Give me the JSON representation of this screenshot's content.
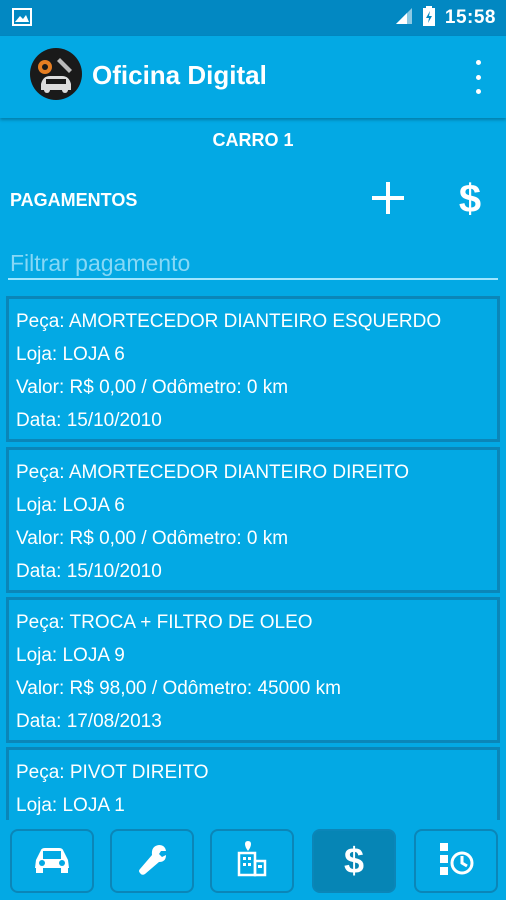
{
  "status_bar": {
    "time": "15:58"
  },
  "app_bar": {
    "title": "Oficina Digital"
  },
  "header": {
    "car_title": "CARRO 1",
    "section_label": "PAGAMENTOS",
    "add_icon": "plus-icon",
    "payment_icon": "dollar-icon",
    "payment_symbol": "$"
  },
  "filter": {
    "placeholder": "Filtrar pagamento",
    "value": ""
  },
  "payments": [
    {
      "peca": "Peça: AMORTECEDOR DIANTEIRO ESQUERDO",
      "loja": "Loja: LOJA 6",
      "valor": "Valor: R$ 0,00 / Odômetro: 0 km",
      "data": "Data: 15/10/2010"
    },
    {
      "peca": "Peça: AMORTECEDOR DIANTEIRO DIREITO",
      "loja": "Loja: LOJA 6",
      "valor": "Valor: R$ 0,00 / Odômetro: 0 km",
      "data": "Data: 15/10/2010"
    },
    {
      "peca": "Peça: TROCA + FILTRO DE OLEO",
      "loja": "Loja: LOJA 9",
      "valor": "Valor: R$ 98,00 / Odômetro: 45000 km",
      "data": "Data: 17/08/2013"
    },
    {
      "peca": "Peça: PIVOT DIREITO",
      "loja": "Loja: LOJA 1"
    }
  ],
  "bottom_nav": {
    "items": [
      {
        "icon": "car-icon",
        "active": false
      },
      {
        "icon": "wrench-icon",
        "active": false
      },
      {
        "icon": "building-icon",
        "active": false
      },
      {
        "icon": "dollar-icon",
        "active": true,
        "symbol": "$"
      },
      {
        "icon": "history-icon",
        "active": false
      }
    ]
  },
  "colors": {
    "background": "#03a9e4",
    "status_bar": "#0288c2",
    "card_border": "#0b86b8",
    "active_nav": "#0685b5",
    "text": "#ffffff"
  }
}
